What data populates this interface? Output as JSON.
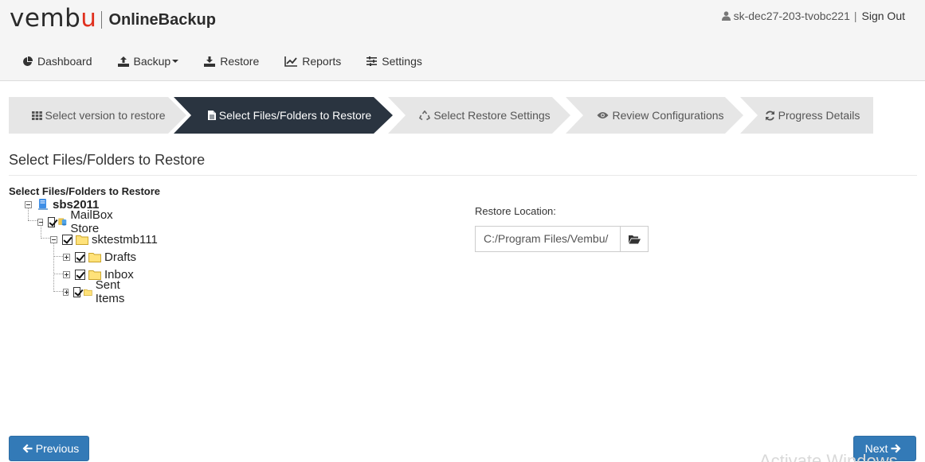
{
  "header": {
    "logo_text": "vembu",
    "product": "OnlineBackup",
    "username": "sk-dec27-203-tvobc221",
    "separator": "|",
    "signout": "Sign Out"
  },
  "nav": [
    {
      "label": "Dashboard",
      "icon": "pie-chart-icon"
    },
    {
      "label": "Backup",
      "icon": "upload-icon",
      "dropdown": true
    },
    {
      "label": "Restore",
      "icon": "download-icon"
    },
    {
      "label": "Reports",
      "icon": "line-chart-icon"
    },
    {
      "label": "Settings",
      "icon": "sliders-icon"
    }
  ],
  "steps": [
    {
      "label": "Select version to restore",
      "icon": "grid-icon",
      "state": "done"
    },
    {
      "label": "Select Files/Folders to Restore",
      "icon": "file-icon",
      "state": "active"
    },
    {
      "label": "Select Restore Settings",
      "icon": "recycle-icon",
      "state": "pending"
    },
    {
      "label": "Review Configurations",
      "icon": "eye-icon",
      "state": "pending"
    },
    {
      "label": "Progress Details",
      "icon": "refresh-icon",
      "state": "pending"
    }
  ],
  "page_title": "Select Files/Folders to Restore",
  "tree": {
    "title": "Select Files/Folders to Restore",
    "root": "sbs2011",
    "store": "MailBox Store",
    "mailbox": "sktestmb111",
    "folders": [
      "Drafts",
      "Inbox",
      "Sent Items"
    ]
  },
  "restore_location": {
    "label": "Restore Location:",
    "value": "C:/Program Files/Vembu/"
  },
  "buttons": {
    "previous": "Previous",
    "next": "Next"
  },
  "watermark": "Activate Windows",
  "colors": {
    "active_step": "#2a3440",
    "inactive_step": "#e6e6e6",
    "primary_button": "#337ab7",
    "logo_accent": "#e0301e"
  }
}
